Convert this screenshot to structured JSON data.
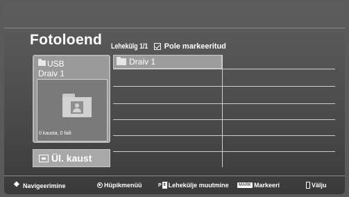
{
  "header": {
    "title": "Fotoloend",
    "page_info": "Lehekülg 1/1",
    "mark_status": "Pole markeeritud"
  },
  "drive_panel": {
    "device_label": "USB",
    "drive_name": "Draiv 1",
    "file_count": "0 kausta, 0 faili"
  },
  "upper_folder_button": {
    "label": "Ül. kaust"
  },
  "file_list": {
    "items": [
      {
        "label": "Draiv 1",
        "icon": "folder-icon",
        "selected": true
      }
    ],
    "rows": 7,
    "columns": 2
  },
  "help_bar": {
    "navigate": "Navigeerimine",
    "popup_menu": "Hüpikmenüü",
    "page_change": "Lehekülje muutmine",
    "mark_key": "MARK",
    "mark": "Markeeri",
    "exit": "Välju"
  }
}
